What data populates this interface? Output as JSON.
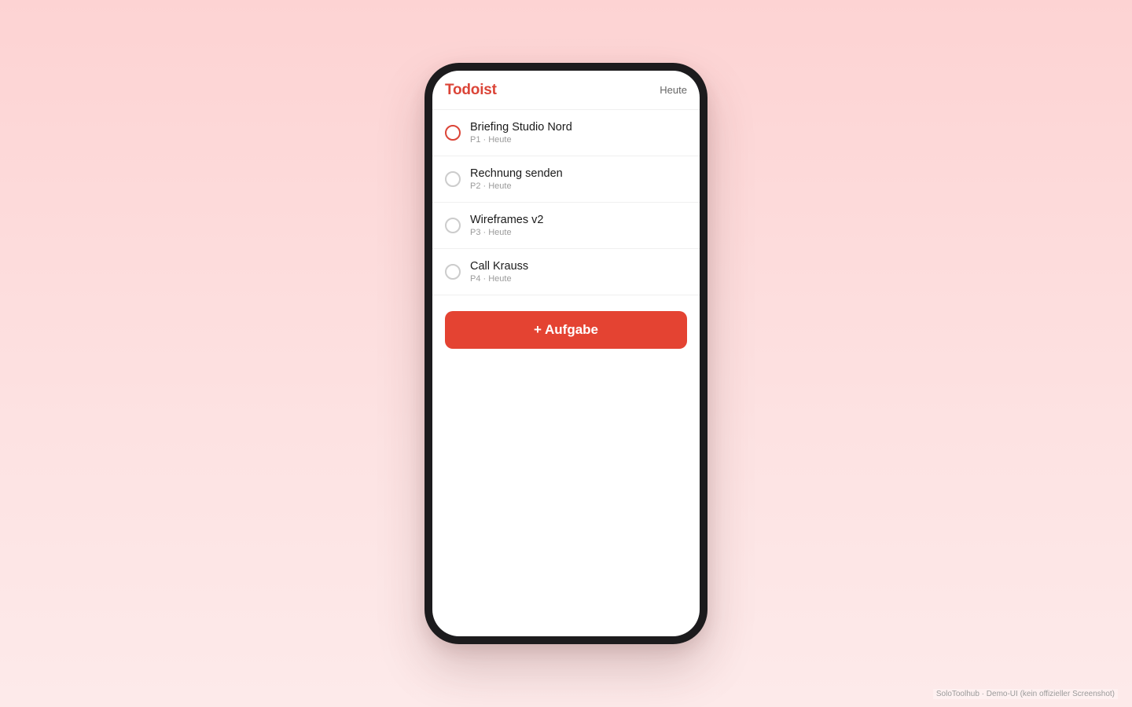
{
  "app": {
    "title": "Todoist",
    "view_label": "Heute",
    "accent_color": "#db4437"
  },
  "tasks": [
    {
      "title": "Briefing Studio Nord",
      "meta": "P1 · Heute",
      "priority": "P1",
      "checkbox_color": "#db4437"
    },
    {
      "title": "Rechnung senden",
      "meta": "P2 · Heute",
      "priority": "P2",
      "checkbox_color": "#cccccc"
    },
    {
      "title": "Wireframes v2",
      "meta": "P3 · Heute",
      "priority": "P3",
      "checkbox_color": "#cccccc"
    },
    {
      "title": "Call Krauss",
      "meta": "P4 · Heute",
      "priority": "P4",
      "checkbox_color": "#cccccc"
    }
  ],
  "add_button": {
    "label": "+ Aufgabe",
    "color": "#e44332"
  },
  "watermark": "SoloToolhub · Demo-UI (kein offizieller Screenshot)"
}
